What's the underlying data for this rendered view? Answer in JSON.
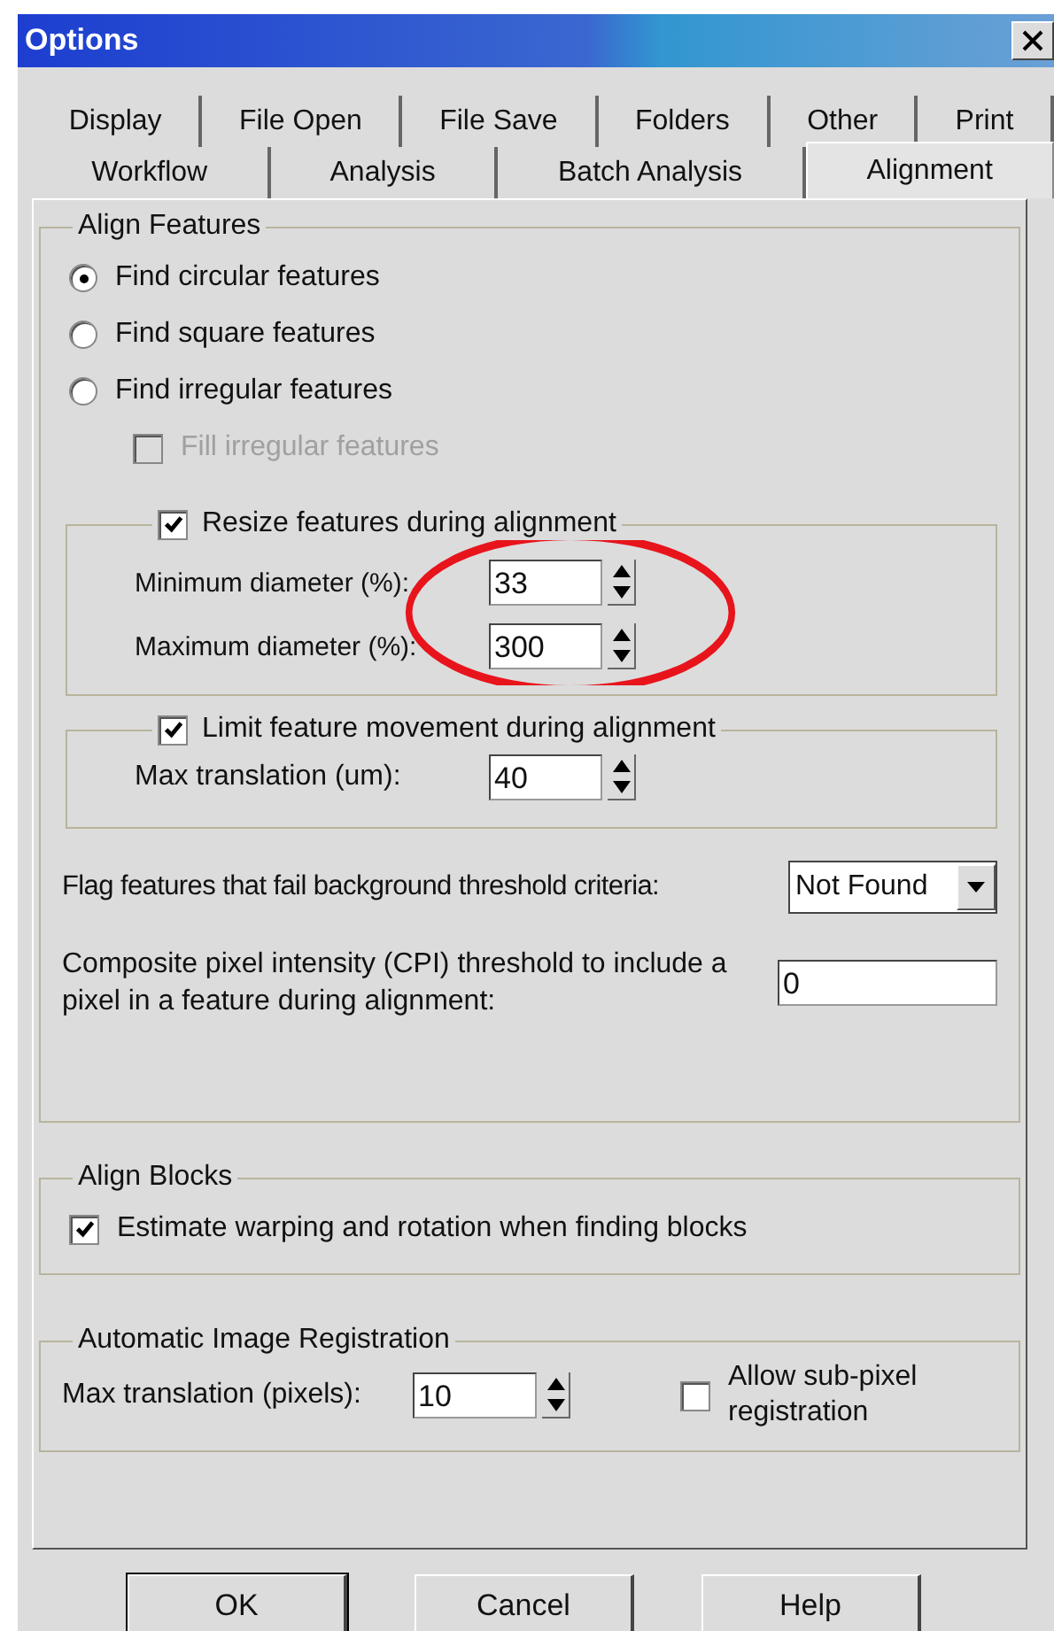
{
  "window": {
    "title": "Options"
  },
  "tab_rows": [
    [
      {
        "label": "Display",
        "selected": false
      },
      {
        "label": "File Open",
        "selected": false
      },
      {
        "label": "File Save",
        "selected": false
      },
      {
        "label": "Folders",
        "selected": false
      },
      {
        "label": "Other",
        "selected": false
      },
      {
        "label": "Print",
        "selected": false
      }
    ],
    [
      {
        "label": "Workflow",
        "selected": false
      },
      {
        "label": "Analysis",
        "selected": false
      },
      {
        "label": "Batch Analysis",
        "selected": false
      },
      {
        "label": "Alignment",
        "selected": true
      }
    ]
  ],
  "align_features": {
    "title": "Align Features",
    "shape_options": [
      {
        "label": "Find circular features",
        "selected": true
      },
      {
        "label": "Find square features",
        "selected": false
      },
      {
        "label": "Find irregular features",
        "selected": false
      }
    ],
    "fill_irregular": {
      "label": "Fill irregular features",
      "checked": false,
      "disabled": true
    },
    "resize_group": {
      "label": "Resize features during alignment",
      "checked": true,
      "fields": [
        {
          "label": "Minimum diameter (%):",
          "value": "33"
        },
        {
          "label": "Maximum diameter (%):",
          "value": "300"
        }
      ]
    },
    "limit_group": {
      "label": "Limit feature movement during alignment",
      "checked": true,
      "fields": [
        {
          "label": "Max translation (um):",
          "value": "40"
        }
      ]
    },
    "flag": {
      "label": "Flag features that fail background threshold criteria:",
      "value": "Not Found"
    },
    "cpi": {
      "label": "Composite pixel intensity (CPI) threshold to include a pixel in a feature during alignment:",
      "value": "0"
    }
  },
  "align_blocks": {
    "title": "Align Blocks",
    "estimate": {
      "label": "Estimate warping and rotation when finding blocks",
      "checked": true
    }
  },
  "registration": {
    "title": "Automatic Image Registration",
    "max_translation": {
      "label": "Max translation (pixels):",
      "value": "10"
    },
    "subpixel": {
      "label": "Allow sub-pixel registration",
      "checked": false
    }
  },
  "annotations": [
    {
      "kind": "ellipse"
    }
  ],
  "buttons": [
    "OK",
    "Cancel",
    "Help"
  ]
}
